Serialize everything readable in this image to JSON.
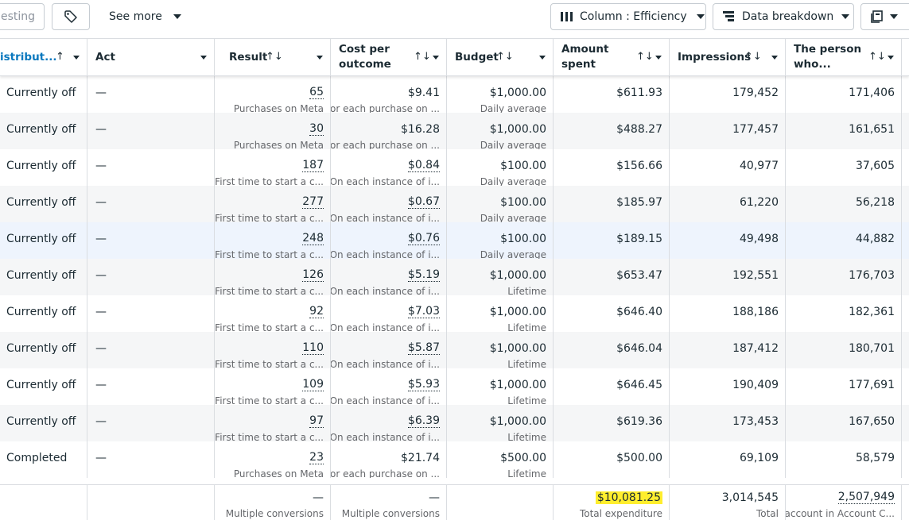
{
  "toolbar": {
    "testing_label": "esting",
    "see_more_label": "See more",
    "column_label": "Column : Efficiency",
    "breakdown_label": "Data breakdown"
  },
  "columns": {
    "distribution": "istribut...",
    "act": "Act",
    "result": "Result",
    "cost_per_outcome_line1": "Cost per",
    "cost_per_outcome_line2": "outcome",
    "budget": "Budget",
    "amount_spent_line1": "Amount",
    "amount_spent_line2": "spent",
    "impressions": "Impressions",
    "reach_line1": "The person",
    "reach_line2": "who..."
  },
  "rows": [
    {
      "status": "Currently off",
      "act": "—",
      "result": "65",
      "result_sub": "Purchases on Meta",
      "cost": "$9.41",
      "cost_sub": "For each purchase on ...",
      "budget": "$1,000.00",
      "budget_sub": "Daily average",
      "spent": "$611.93",
      "impressions": "179,452",
      "reach": "171,406"
    },
    {
      "status": "Currently off",
      "act": "—",
      "result": "30",
      "result_sub": "Purchases on Meta",
      "cost": "$16.28",
      "cost_sub": "For each purchase on ...",
      "budget": "$1,000.00",
      "budget_sub": "Daily average",
      "spent": "$488.27",
      "impressions": "177,457",
      "reach": "161,651"
    },
    {
      "status": "Currently off",
      "act": "—",
      "result": "187",
      "result_sub": "First time to start a c...",
      "cost": "$0.84",
      "cost_sub": "On each instance of i...",
      "budget": "$100.00",
      "budget_sub": "Daily average",
      "spent": "$156.66",
      "impressions": "40,977",
      "reach": "37,605"
    },
    {
      "status": "Currently off",
      "act": "—",
      "result": "277",
      "result_sub": "First time to start a c...",
      "cost": "$0.67",
      "cost_sub": "On each instance of i...",
      "budget": "$100.00",
      "budget_sub": "Daily average",
      "spent": "$185.97",
      "impressions": "61,220",
      "reach": "56,218"
    },
    {
      "status": "Currently off",
      "act": "—",
      "result": "248",
      "result_sub": "First time to start a c...",
      "cost": "$0.76",
      "cost_sub": "On each instance of i...",
      "budget": "$100.00",
      "budget_sub": "Daily average",
      "spent": "$189.15",
      "impressions": "49,498",
      "reach": "44,882"
    },
    {
      "status": "Currently off",
      "act": "—",
      "result": "126",
      "result_sub": "First time to start a c...",
      "cost": "$5.19",
      "cost_sub": "On each instance of i...",
      "budget": "$1,000.00",
      "budget_sub": "Lifetime",
      "spent": "$653.47",
      "impressions": "192,551",
      "reach": "176,703"
    },
    {
      "status": "Currently off",
      "act": "—",
      "result": "92",
      "result_sub": "First time to start a c...",
      "cost": "$7.03",
      "cost_sub": "On each instance of i...",
      "budget": "$1,000.00",
      "budget_sub": "Lifetime",
      "spent": "$646.40",
      "impressions": "188,186",
      "reach": "182,361"
    },
    {
      "status": "Currently off",
      "act": "—",
      "result": "110",
      "result_sub": "First time to start a c...",
      "cost": "$5.87",
      "cost_sub": "On each instance of i...",
      "budget": "$1,000.00",
      "budget_sub": "Lifetime",
      "spent": "$646.04",
      "impressions": "187,412",
      "reach": "180,701"
    },
    {
      "status": "Currently off",
      "act": "—",
      "result": "109",
      "result_sub": "First time to start a c...",
      "cost": "$5.93",
      "cost_sub": "On each instance of i...",
      "budget": "$1,000.00",
      "budget_sub": "Lifetime",
      "spent": "$646.45",
      "impressions": "190,409",
      "reach": "177,691"
    },
    {
      "status": "Currently off",
      "act": "—",
      "result": "97",
      "result_sub": "First time to start a c...",
      "cost": "$6.39",
      "cost_sub": "On each instance of i...",
      "budget": "$1,000.00",
      "budget_sub": "Lifetime",
      "spent": "$619.36",
      "impressions": "173,453",
      "reach": "167,650"
    },
    {
      "status": "Completed",
      "act": "—",
      "result": "23",
      "result_sub": "Purchases on Meta",
      "cost": "$21.74",
      "cost_sub": "For each purchase on ...",
      "budget": "$500.00",
      "budget_sub": "Lifetime",
      "spent": "$500.00",
      "impressions": "69,109",
      "reach": "58,579"
    }
  ],
  "totals": {
    "result": "—",
    "result_sub": "Multiple conversions",
    "cost": "—",
    "cost_sub": "Multiple conversions",
    "spent": "$10,081.25",
    "spent_sub": "Total expenditure",
    "impressions": "3,014,545",
    "impressions_sub": "Total",
    "reach": "2,507,949",
    "reach_sub": "account in Account C..."
  },
  "colors": {
    "row_alt": "#f5f6f7",
    "row_hover": "#eef4fd",
    "highlight": "#ffee2e",
    "sort_active": "#0a78be"
  }
}
